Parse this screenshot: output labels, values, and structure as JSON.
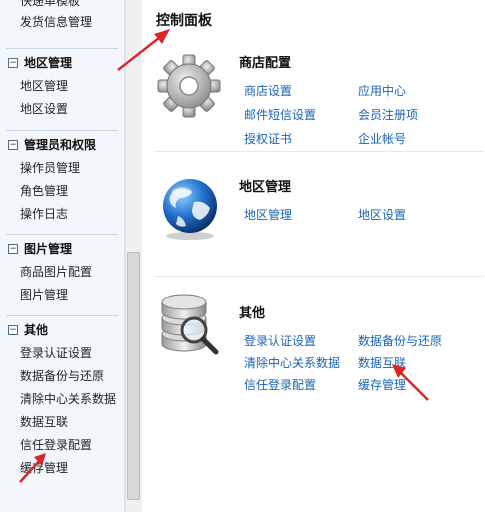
{
  "sidebar": {
    "top_items": [
      "快递单模板",
      "发货信息管理"
    ],
    "groups": [
      {
        "title": "地区管理",
        "toggle": "−",
        "items": [
          "地区管理",
          "地区设置"
        ]
      },
      {
        "title": "管理员和权限",
        "toggle": "−",
        "items": [
          "操作员管理",
          "角色管理",
          "操作日志"
        ]
      },
      {
        "title": "图片管理",
        "toggle": "−",
        "items": [
          "商品图片配置",
          "图片管理"
        ]
      },
      {
        "title": "其他",
        "toggle": "−",
        "items": [
          "登录认证设置",
          "数据备份与还原",
          "清除中心关系数据",
          "数据互联",
          "信任登录配置",
          "缓存管理"
        ]
      }
    ]
  },
  "main": {
    "title": "控制面板",
    "sections": [
      {
        "title": "商店配置",
        "links": [
          "商店设置",
          "应用中心",
          "邮件短信设置",
          "会员注册项",
          "授权证书",
          "企业帐号"
        ]
      },
      {
        "title": "地区管理",
        "links": [
          "地区管理",
          "地区设置"
        ]
      },
      {
        "title": "其他",
        "links": [
          "登录认证设置",
          "数据备份与还原",
          "清除中心关系数据",
          "数据互联",
          "信任登录配置",
          "缓存管理"
        ]
      }
    ]
  },
  "colors": {
    "link": "#1a63b3",
    "arrow": "#d9262b",
    "sidebar_bg": "#f3f7fb"
  },
  "icons": [
    "gear-icon",
    "globe-icon",
    "database-search-icon",
    "collapse-toggle-icon"
  ]
}
